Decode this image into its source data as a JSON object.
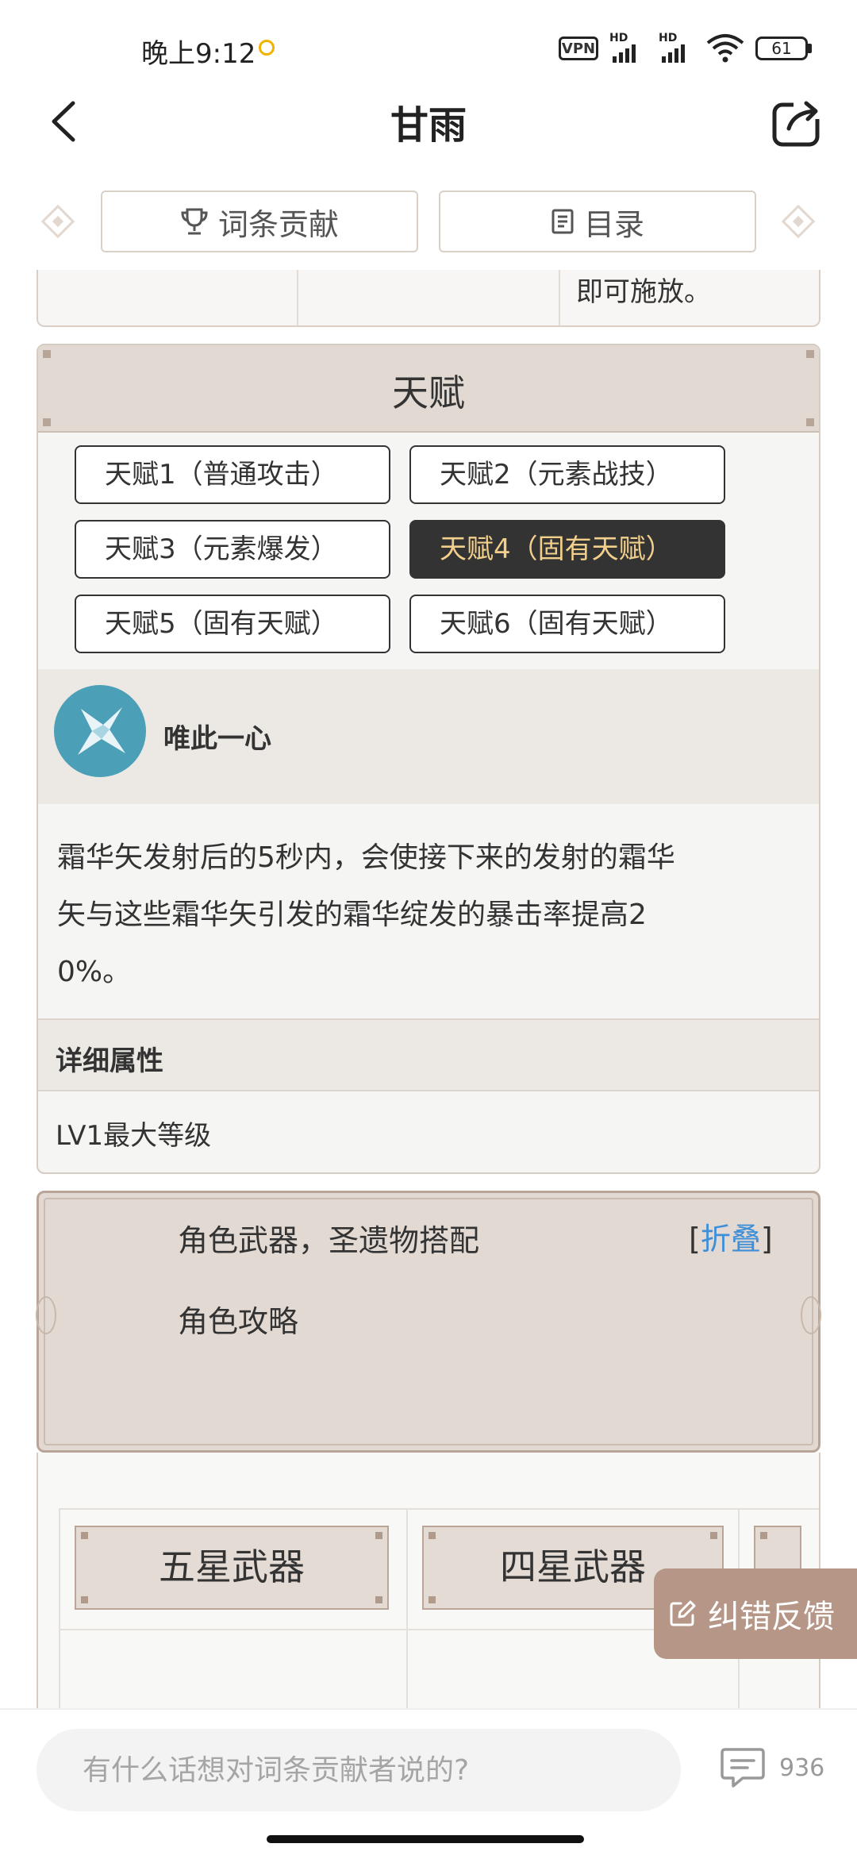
{
  "status_bar": {
    "time": "晚上9:12",
    "vpn": "VPN",
    "signal_label": "HD",
    "battery": "61"
  },
  "header": {
    "title": "甘雨"
  },
  "top_tabs": {
    "contribute": "词条贡献",
    "catalog": "目录"
  },
  "prev_section": {
    "trailing_text": "即可施放。"
  },
  "talent": {
    "title": "天赋",
    "buttons": [
      "天赋1（普通攻击）",
      "天赋2（元素战技）",
      "天赋3（元素爆发）",
      "天赋4（固有天赋）",
      "天赋5（固有天赋）",
      "天赋6（固有天赋）"
    ],
    "active_index": 3,
    "skill_name": "唯此一心",
    "description_lines": [
      "霜华矢发射后的5秒内，会使接下来的发射的霜华",
      "矢与这些霜华矢引发的霜华绽发的暴击率提高2",
      "0%。"
    ],
    "detail_title": "详细属性",
    "detail_value": "LV1最大等级"
  },
  "build": {
    "link1": "角色武器，圣遗物搭配",
    "link2": "角色攻略",
    "collapse_open": "[",
    "collapse_label": "折叠",
    "collapse_close": "]"
  },
  "weapons": {
    "tabs": [
      "五星武器",
      "四星武器"
    ]
  },
  "feedback": {
    "label": "纠错反馈"
  },
  "comment": {
    "placeholder": "有什么话想对词条贡献者说的?",
    "count": "936"
  },
  "colors": {
    "active_tab_bg": "#333333",
    "active_tab_text": "#f2cf8a",
    "link_blue": "#3f8fd8",
    "feedback_bg": "#b69787",
    "section_header_bg": "#e1d9d2"
  }
}
